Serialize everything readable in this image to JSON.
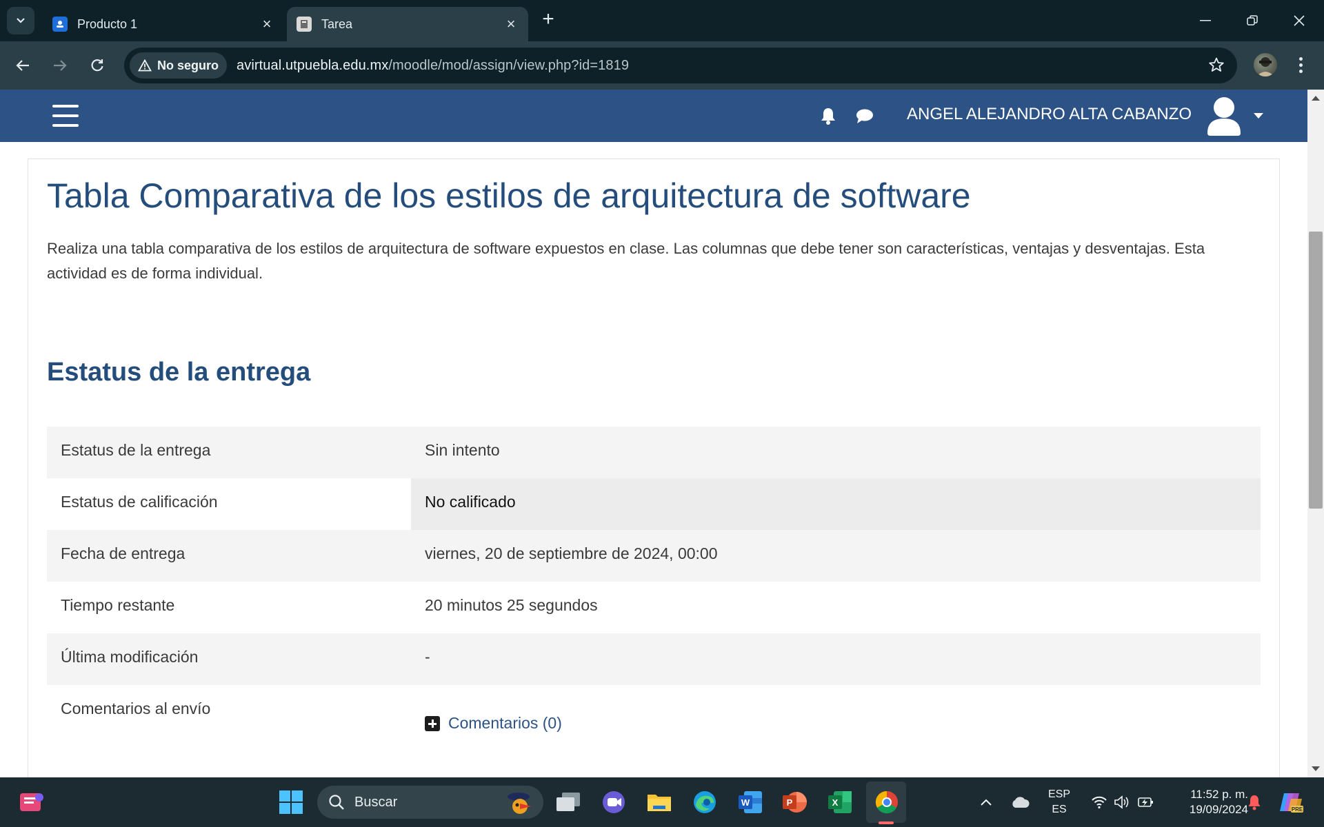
{
  "browser": {
    "tabs": [
      {
        "title": "Producto 1",
        "icon": "google-classroom-icon",
        "active": false
      },
      {
        "title": "Tarea",
        "icon": "moodle-tab-icon",
        "active": true
      }
    ],
    "security_label": "No seguro",
    "url_host": "avirtual.utpuebla.edu.mx",
    "url_path": "/moodle/mod/assign/view.php?id=1819"
  },
  "moodle": {
    "user_name": "ANGEL ALEJANDRO ALTA CABANZO"
  },
  "assignment": {
    "title": "Tabla Comparativa de los estilos de arquitectura de software",
    "intro": "Realiza una tabla comparativa de los estilos de arquitectura de software expuestos en clase. Las columnas que debe tener son características, ventajas y desventajas. Esta actividad es de forma individual.",
    "status_heading": "Estatus de la entrega",
    "rows": [
      {
        "label": "Estatus de la entrega",
        "value": "Sin intento"
      },
      {
        "label": "Estatus de calificación",
        "value": "No calificado"
      },
      {
        "label": "Fecha de entrega",
        "value": "viernes, 20 de septiembre de 2024, 00:00"
      },
      {
        "label": "Tiempo restante",
        "value": "20 minutos 25 segundos"
      },
      {
        "label": "Última modificación",
        "value": "-"
      },
      {
        "label": "Comentarios al envío",
        "value": "Comentarios (0)"
      }
    ]
  },
  "taskbar": {
    "search_placeholder": "Buscar",
    "lang_top": "ESP",
    "lang_bottom": "ES",
    "time": "11:52 p. m.",
    "date": "19/09/2024",
    "apps": [
      "news-widget-icon",
      "windows-start-icon",
      "task-view-icon",
      "teams-icon",
      "file-explorer-icon",
      "edge-icon",
      "word-icon",
      "powerpoint-icon",
      "excel-icon",
      "chrome-icon"
    ]
  },
  "colors": {
    "moodle_nav": "#2d5286",
    "heading_blue": "#244d7c",
    "browser_dark": "#0f2128",
    "browser_toolbar": "#2a3f47"
  }
}
